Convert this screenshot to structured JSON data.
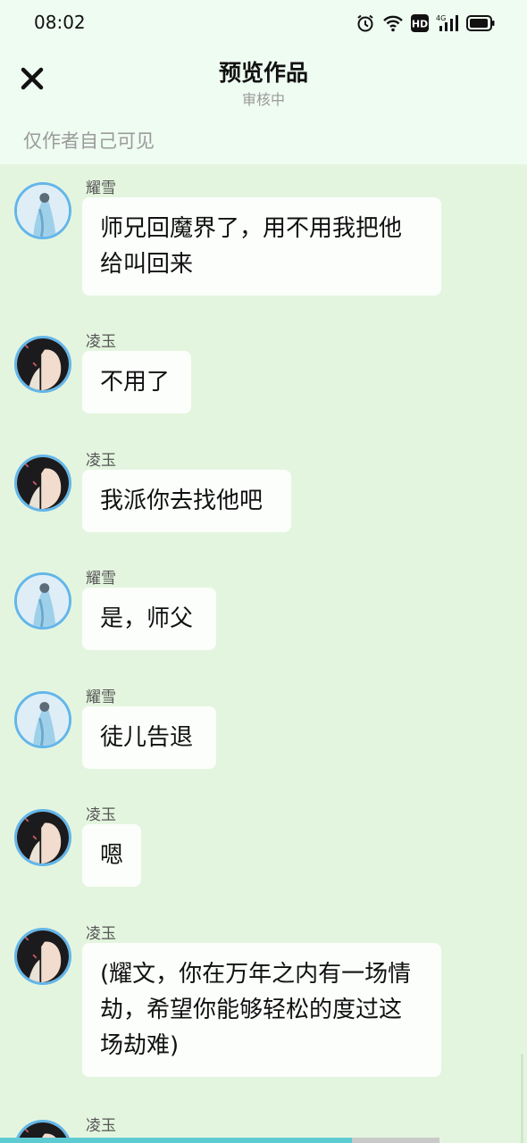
{
  "status_bar": {
    "time": "08:02",
    "icons": [
      "alarm-icon",
      "wifi-icon",
      "hd-icon",
      "signal-4g-icon",
      "battery-icon"
    ]
  },
  "header": {
    "title": "预览作品",
    "subtitle": "审核中",
    "close_icon": "close-icon",
    "visibility_note": "仅作者自己可见"
  },
  "colors": {
    "background": "#e4f5df",
    "header_bg": "#effcf2",
    "avatar_ring": "#63b6ea",
    "progress_fill": "#5ecbd3"
  },
  "messages": [
    {
      "sender": "耀雪",
      "avatar": "yaoxue-avatar",
      "text": "师兄回魔界了，用不用我把他给叫回来"
    },
    {
      "sender": "凌玉",
      "avatar": "lingyu-avatar",
      "text": "不用了"
    },
    {
      "sender": "凌玉",
      "avatar": "lingyu-avatar",
      "text": "我派你去找他吧"
    },
    {
      "sender": "耀雪",
      "avatar": "yaoxue-avatar",
      "text": "是，师父"
    },
    {
      "sender": "耀雪",
      "avatar": "yaoxue-avatar",
      "text": "徒儿告退"
    },
    {
      "sender": "凌玉",
      "avatar": "lingyu-avatar",
      "text": "嗯"
    },
    {
      "sender": "凌玉",
      "avatar": "lingyu-avatar",
      "text": "(耀文，你在万年之内有一场情劫，希望你能够轻松的度过这场劫难)"
    },
    {
      "sender": "凌玉",
      "avatar": "lingyu-avatar",
      "text": ""
    }
  ],
  "progress": 0.8
}
